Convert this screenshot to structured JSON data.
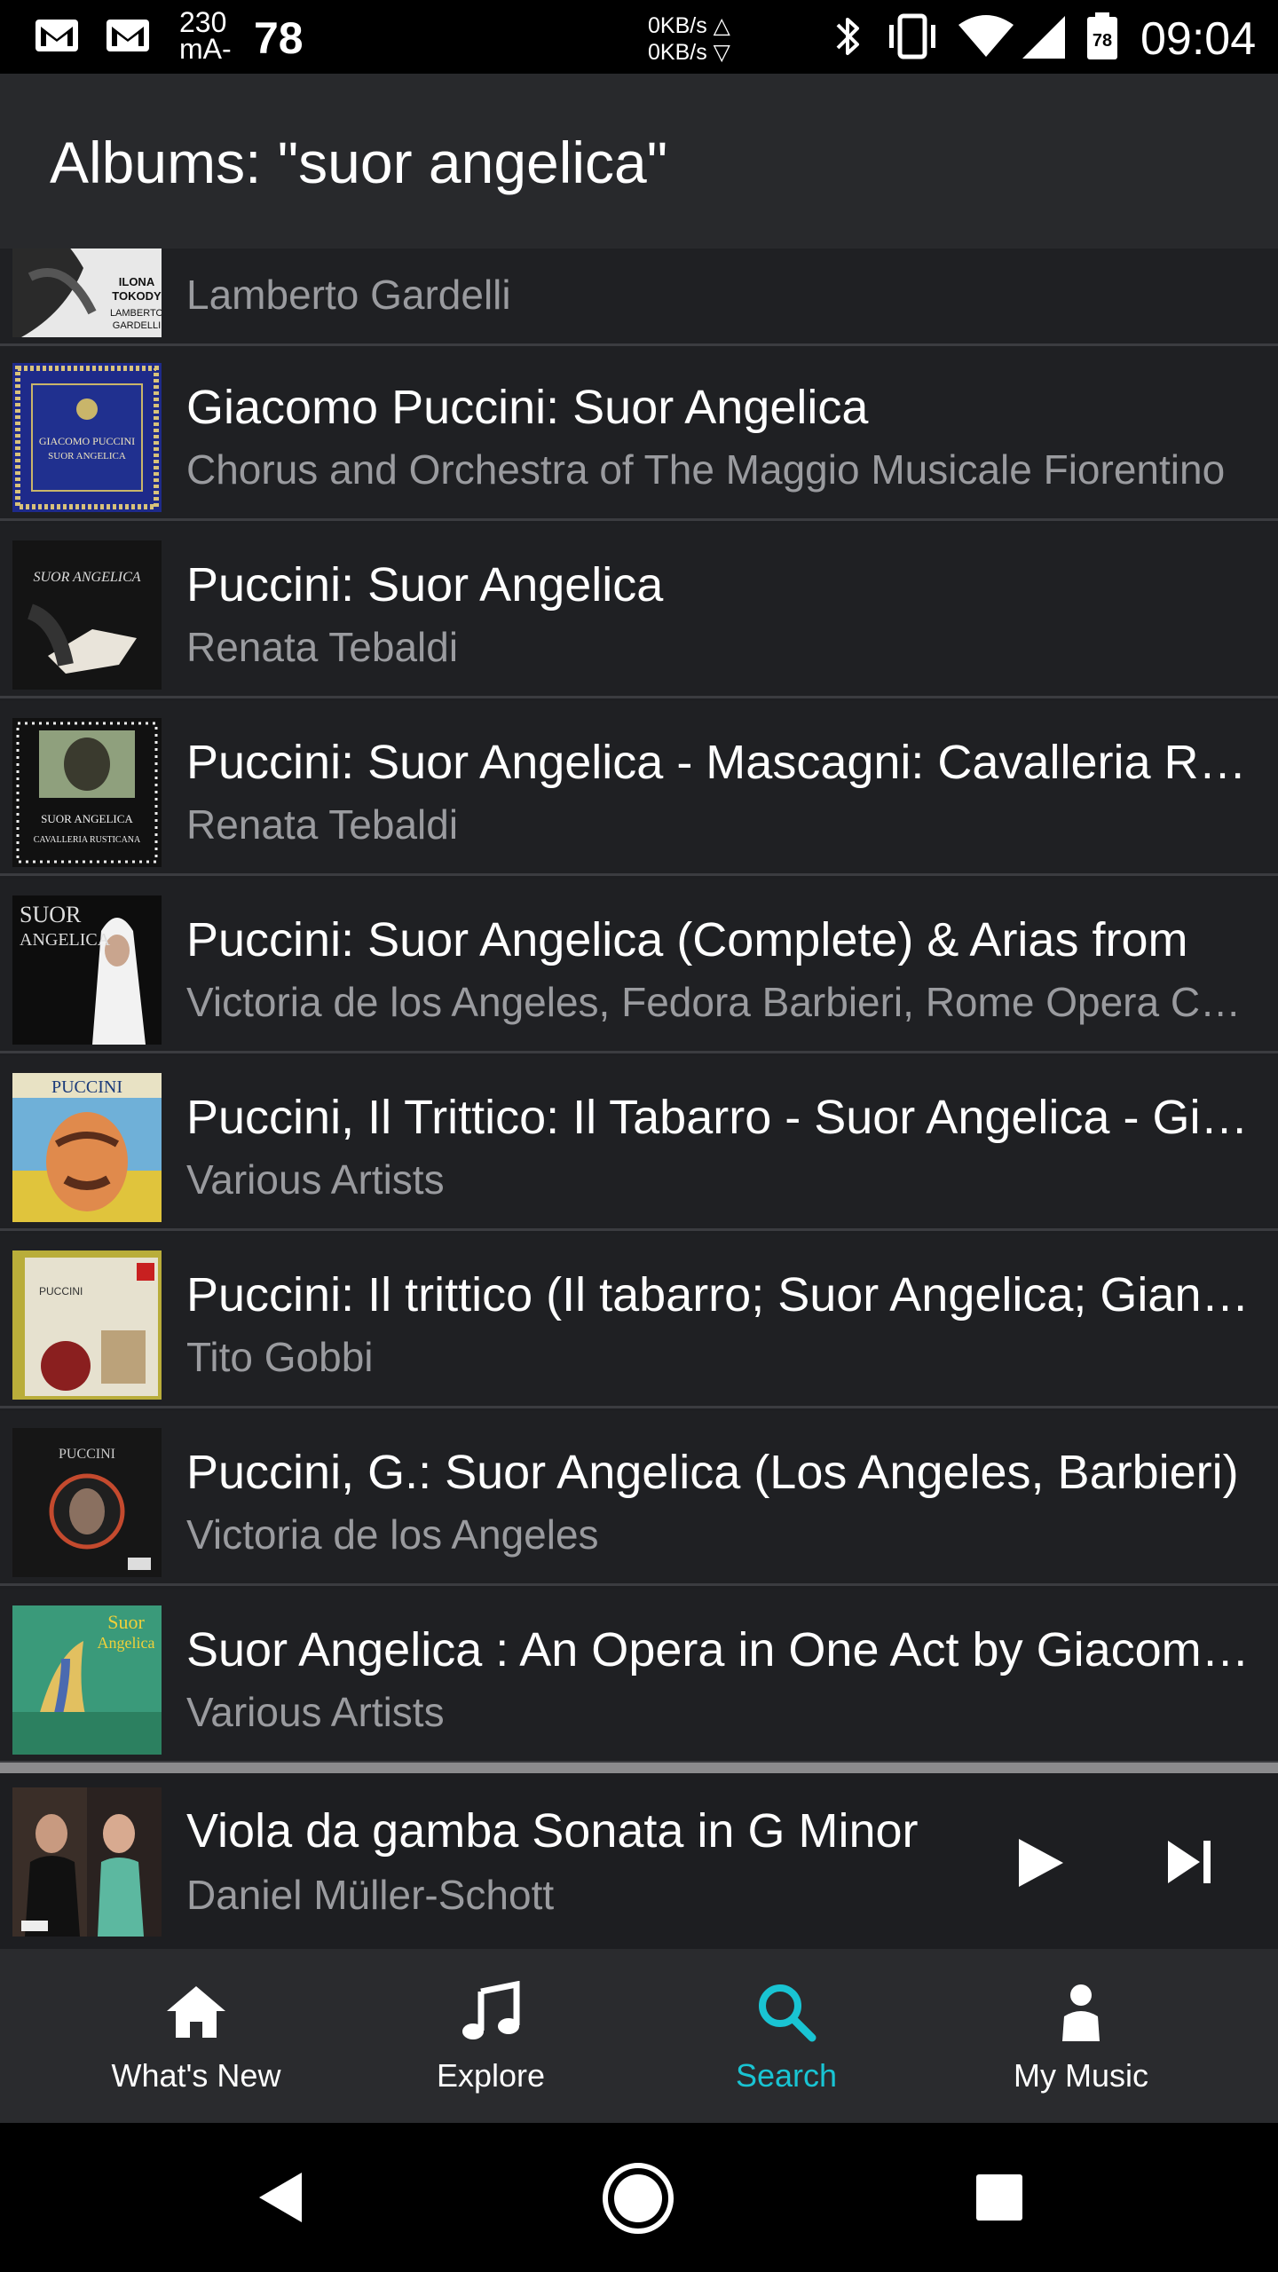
{
  "status_bar": {
    "current_top": "230",
    "current_bottom": "mA-",
    "battery_level": "78",
    "net_up": "0KB/s △",
    "net_down": "0KB/s ▽",
    "battery_icon_text": "78",
    "time": "09:04",
    "icons": [
      "gmail-icon",
      "gmail-icon",
      "bluetooth-icon",
      "vibrate-icon",
      "wifi-icon",
      "signal-icon",
      "battery-icon"
    ]
  },
  "header": {
    "title": "Albums: \"suor angelica\""
  },
  "albums": [
    {
      "title": "",
      "artist": "Lamberto Gardelli"
    },
    {
      "title": "Giacomo Puccini: Suor Angelica",
      "artist": "Chorus and Orchestra of The Maggio Musicale Fiorentino"
    },
    {
      "title": "Puccini: Suor Angelica",
      "artist": "Renata Tebaldi"
    },
    {
      "title": "Puccini: Suor Angelica - Mascagni: Cavalleria Rusticana",
      "artist": "Renata Tebaldi"
    },
    {
      "title": "Puccini: Suor Angelica (Complete) & Arias from",
      "artist": "Victoria de los Angeles, Fedora Barbieri, Rome Opera Chorus"
    },
    {
      "title": "Puccini, Il Trittico: Il Tabarro - Suor Angelica - Gianni Schicchi",
      "artist": "Various Artists"
    },
    {
      "title": "Puccini: Il trittico (Il tabarro; Suor Angelica; Gianni Schicchi)",
      "artist": "Tito Gobbi"
    },
    {
      "title": "Puccini, G.: Suor Angelica (Los Angeles, Barbieri)",
      "artist": "Victoria de los Angeles"
    },
    {
      "title": "Suor Angelica : An Opera in One Act by Giacomo Puccini",
      "artist": "Various Artists"
    }
  ],
  "cover_text": {
    "c0a": "ILONA",
    "c0b": "TOKODY",
    "c0c": "LAMBERTO",
    "c0d": "GARDELLI",
    "c1a": "GIACOMO PUCCINI",
    "c1b": "SUOR ANGELICA",
    "c2": "SUOR ANGELICA",
    "c3a": "SUOR ANGELICA",
    "c3b": "CAVALLERIA RUSTICANA",
    "c4a": "SUOR",
    "c4b": "ANGELICA",
    "c5": "PUCCINI",
    "c6": "PUCCINI",
    "c7": "PUCCINI",
    "c8a": "Suor",
    "c8b": "Angelica"
  },
  "now_playing": {
    "title": "Viola da gamba Sonata in G Minor",
    "artist": "Daniel Müller-Schott"
  },
  "bottom_nav": [
    {
      "label": "What's New",
      "icon": "home-icon"
    },
    {
      "label": "Explore",
      "icon": "music-note-icon"
    },
    {
      "label": "Search",
      "icon": "search-icon",
      "active": true
    },
    {
      "label": "My Music",
      "icon": "person-icon"
    }
  ],
  "colors": {
    "accent": "#19c4d3",
    "background": "#1e1f22",
    "subtitle": "#9a9b9f"
  }
}
